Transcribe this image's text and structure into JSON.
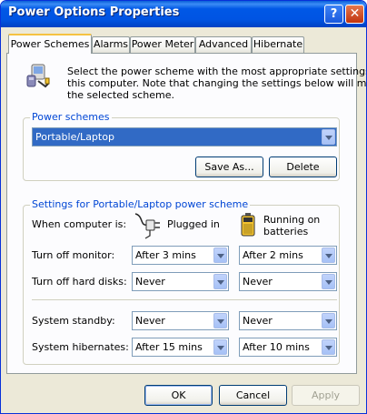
{
  "window": {
    "title": "Power Options Properties",
    "help_label": "?",
    "close_label": "✕"
  },
  "tabs": [
    {
      "label": "Power Schemes",
      "active": true
    },
    {
      "label": "Alarms",
      "active": false
    },
    {
      "label": "Power Meter",
      "active": false
    },
    {
      "label": "Advanced",
      "active": false
    },
    {
      "label": "Hibernate",
      "active": false
    }
  ],
  "intro": {
    "line1": "Select the power scheme with the most appropriate settings for",
    "line2": "this computer. Note that changing the settings below will modify",
    "line3": "the selected scheme."
  },
  "power_schemes": {
    "group_label": "Power schemes",
    "selected": "Portable/Laptop",
    "save_as_label": "Save As...",
    "delete_label": "Delete"
  },
  "settings": {
    "group_label": "Settings for Portable/Laptop power scheme",
    "when_label": "When computer is:",
    "plugged_label": "Plugged in",
    "battery_line1": "Running on",
    "battery_line2": "batteries",
    "rows": [
      {
        "label": "Turn off monitor:",
        "plugged": "After 3 mins",
        "battery": "After 2 mins"
      },
      {
        "label": "Turn off hard disks:",
        "plugged": "Never",
        "battery": "Never"
      },
      {
        "label": "System standby:",
        "plugged": "Never",
        "battery": "Never"
      },
      {
        "label": "System hibernates:",
        "plugged": "After 15 mins",
        "battery": "After 10 mins"
      }
    ]
  },
  "footer": {
    "ok_label": "OK",
    "cancel_label": "Cancel",
    "apply_label": "Apply"
  },
  "colors": {
    "title_bar": "#0054e3",
    "selected_highlight": "#316ac5",
    "group_label": "#0046d5"
  },
  "icons": [
    "power-scheme-icon",
    "plug-icon",
    "battery-icon",
    "help-icon",
    "close-icon",
    "dropdown-arrow-icon"
  ]
}
